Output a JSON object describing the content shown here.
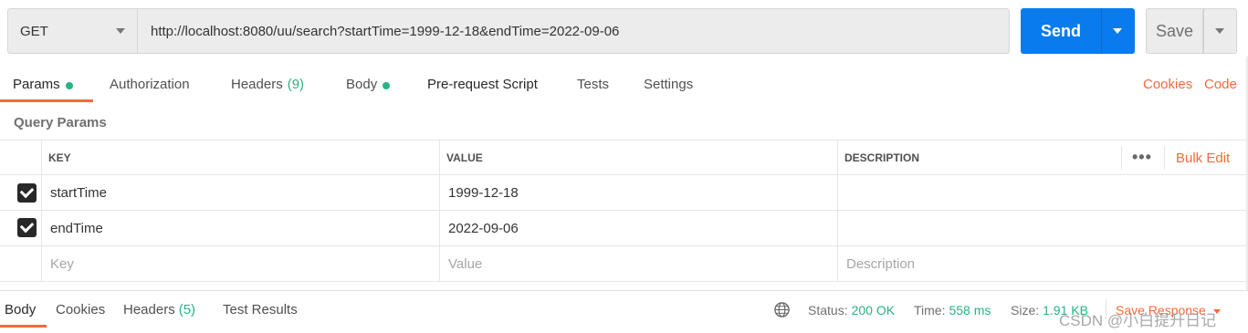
{
  "request": {
    "method": "GET",
    "url": "http://localhost:8080/uu/search?startTime=1999-12-18&endTime=2022-09-06",
    "send_label": "Send",
    "save_label": "Save"
  },
  "tabs": [
    {
      "label": "Params",
      "active": true,
      "dot": true
    },
    {
      "label": "Authorization"
    },
    {
      "label": "Headers",
      "count": "(9)"
    },
    {
      "label": "Body",
      "dot": true
    },
    {
      "label": "Pre-request Script"
    },
    {
      "label": "Tests"
    },
    {
      "label": "Settings"
    }
  ],
  "links": {
    "cookies": "Cookies",
    "code": "Code"
  },
  "params": {
    "section_title": "Query Params",
    "headers": {
      "key": "KEY",
      "value": "VALUE",
      "description": "DESCRIPTION"
    },
    "bulk_edit": "Bulk Edit",
    "more": "•••",
    "rows": [
      {
        "checked": true,
        "key": "startTime",
        "value": "1999-12-18",
        "description": ""
      },
      {
        "checked": true,
        "key": "endTime",
        "value": "2022-09-06",
        "description": ""
      }
    ],
    "placeholders": {
      "key": "Key",
      "value": "Value",
      "description": "Description"
    }
  },
  "response": {
    "tabs": [
      {
        "label": "Body",
        "active": true
      },
      {
        "label": "Cookies"
      },
      {
        "label": "Headers",
        "count": "(5)"
      },
      {
        "label": "Test Results"
      }
    ],
    "status_label": "Status:",
    "status_value": "200 OK",
    "time_label": "Time:",
    "time_value": "558 ms",
    "size_label": "Size:",
    "size_value": "1.91 KB",
    "save_response": "Save Response",
    "icon": "globe-icon"
  },
  "watermark": "CSDN @小白提升日记",
  "colors": {
    "accent": "#f26b3a",
    "send": "#097bed",
    "green": "#26b47f"
  }
}
